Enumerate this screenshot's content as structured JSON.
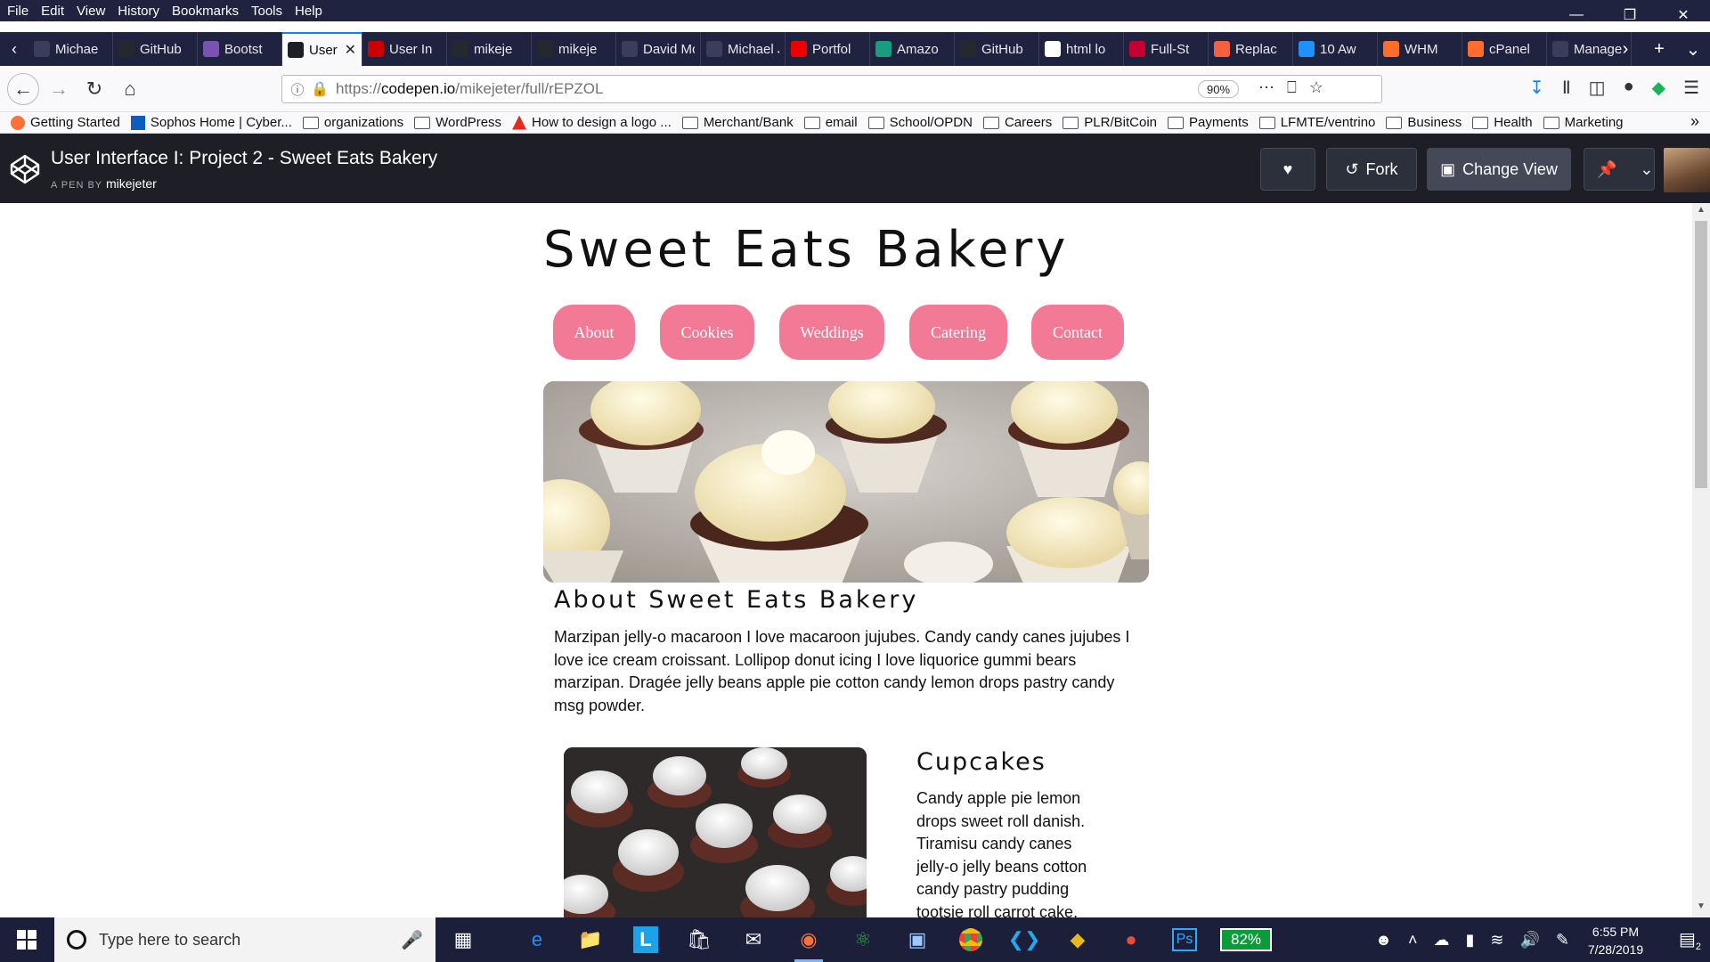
{
  "browser": {
    "menu": [
      "File",
      "Edit",
      "View",
      "History",
      "Bookmarks",
      "Tools",
      "Help"
    ],
    "tabs": [
      {
        "label": "Michae",
        "icon_color": "#3a3d5c"
      },
      {
        "label": "GitHub",
        "icon_color": "#24292e"
      },
      {
        "label": "Bootst",
        "icon_color": "#7952b3"
      },
      {
        "label": "User In",
        "icon_color": "#1e1f26",
        "active": true
      },
      {
        "label": "User In",
        "icon_color": "#c00"
      },
      {
        "label": "mikeje",
        "icon_color": "#24292e"
      },
      {
        "label": "mikeje",
        "icon_color": "#24292e"
      },
      {
        "label": "David Mo",
        "icon_color": "#3a3d5c"
      },
      {
        "label": "Michael Je",
        "icon_color": "#3a3d5c"
      },
      {
        "label": "Portfol",
        "icon_color": "#e00"
      },
      {
        "label": "Amazo",
        "icon_color": "#1a9c80"
      },
      {
        "label": "GitHub",
        "icon_color": "#24292e"
      },
      {
        "label": "html lo",
        "icon_color": "#fff"
      },
      {
        "label": "Full-St",
        "icon_color": "#c3002f"
      },
      {
        "label": "Replac",
        "icon_color": "#f56040"
      },
      {
        "label": "10 Aw",
        "icon_color": "#1e90ff"
      },
      {
        "label": "WHM",
        "icon_color": "#ff6c2c"
      },
      {
        "label": "cPanel",
        "icon_color": "#ff6c2c"
      },
      {
        "label": "Manage m",
        "icon_color": "#3a3d5c"
      }
    ],
    "url_prefix": "https://",
    "url_domain": "codepen.io",
    "url_path": "/mikejeter/full/rEPZOL",
    "zoom": "90%",
    "bookmarks": [
      {
        "label": "Getting Started",
        "type": "firefox"
      },
      {
        "label": "Sophos Home | Cyber...",
        "type": "sophos"
      },
      {
        "label": "organizations",
        "type": "folder"
      },
      {
        "label": "WordPress",
        "type": "folder"
      },
      {
        "label": "How to design a logo ...",
        "type": "adobe"
      },
      {
        "label": "Merchant/Bank",
        "type": "folder"
      },
      {
        "label": "email",
        "type": "folder"
      },
      {
        "label": "School/OPDN",
        "type": "folder"
      },
      {
        "label": "Careers",
        "type": "folder"
      },
      {
        "label": "PLR/BitCoin",
        "type": "folder"
      },
      {
        "label": "Payments",
        "type": "folder"
      },
      {
        "label": "LFMTE/ventrino",
        "type": "folder"
      },
      {
        "label": "Business",
        "type": "folder"
      },
      {
        "label": "Health",
        "type": "folder"
      },
      {
        "label": "Marketing",
        "type": "folder"
      }
    ]
  },
  "codepen": {
    "title": "User Interface I: Project 2 - Sweet Eats Bakery",
    "by_prefix": "A PEN BY",
    "author": "mikejeter",
    "fork_label": "Fork",
    "change_view_label": "Change View"
  },
  "page": {
    "title": "Sweet Eats Bakery",
    "nav": [
      "About",
      "Cookies",
      "Weddings",
      "Catering",
      "Contact"
    ],
    "about_heading": "About Sweet Eats Bakery",
    "about_text": "Marzipan jelly-o macaroon I love macaroon jujubes. Candy candy canes jujubes I love ice cream croissant. Lollipop donut icing I love liquorice gummi bears marzipan. Dragée jelly beans apple pie cotton candy lemon drops pastry candy msg powder.",
    "cupcakes_heading": "Cupcakes",
    "cupcakes_text": "Candy apple pie lemon drops sweet roll danish. Tiramisu candy canes jelly-o jelly beans cotton candy pastry pudding tootsie roll carrot cake.",
    "nav_color": "#f27a97"
  },
  "taskbar": {
    "search_placeholder": "Type here to search",
    "battery": "82%",
    "time": "6:55 PM",
    "date": "7/28/2019",
    "notifications": "2"
  }
}
